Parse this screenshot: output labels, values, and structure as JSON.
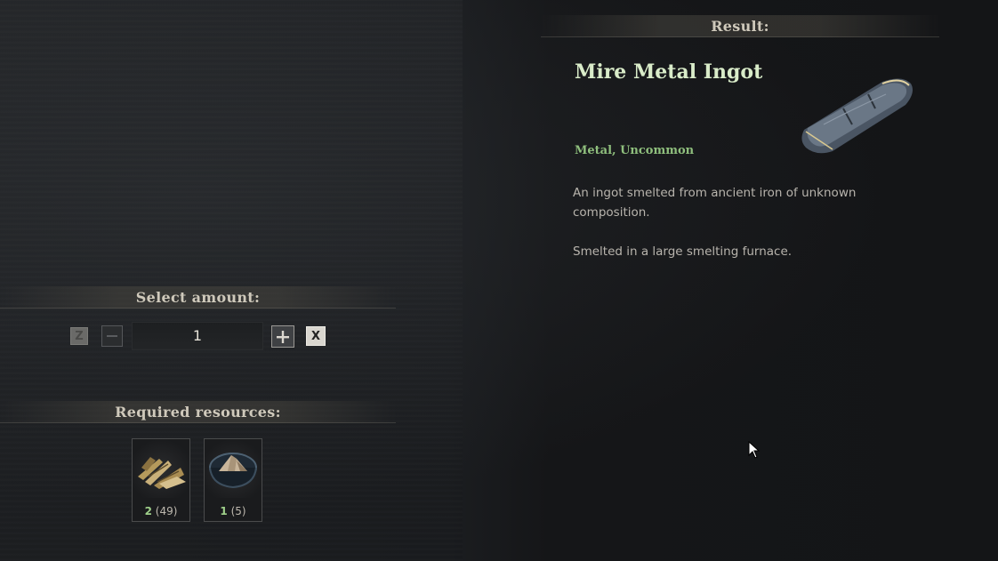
{
  "amount_section": {
    "title": "Select amount:",
    "z_label": "Z",
    "minus_label": "−",
    "value": "1",
    "plus_label": "+",
    "x_label": "X"
  },
  "resources_section": {
    "title": "Required resources:",
    "items": [
      {
        "icon": "bone-shards-icon",
        "required": "2",
        "owned": "(49)"
      },
      {
        "icon": "ore-bowl-icon",
        "required": "1",
        "owned": "(5)"
      }
    ]
  },
  "result": {
    "header": "Result:",
    "item_name": "Mire Metal Ingot",
    "item_type": "Metal, Uncommon",
    "description": [
      "An ingot smelted from ancient iron of unknown composition.",
      "Smelted in a large smelting furnace."
    ],
    "icon": "metal-ingot-icon"
  },
  "colors": {
    "title_green": "#d9ecc9",
    "type_green": "#8fbf7d",
    "count_green": "#9fd08a",
    "header_text": "#cfc9bb"
  }
}
